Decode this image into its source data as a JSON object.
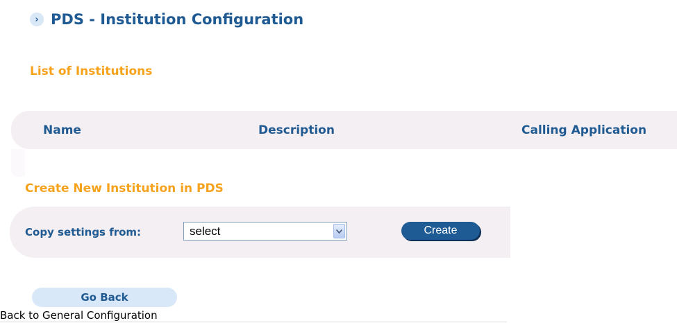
{
  "page": {
    "title": "PDS - Institution Configuration",
    "title_icon": "chevron-right-icon"
  },
  "institutions": {
    "heading": "List of Institutions",
    "columns": [
      "Name",
      "Description",
      "Calling Application"
    ],
    "rows": []
  },
  "create": {
    "heading": "Create New Institution in PDS",
    "copy_label": "Copy settings from:",
    "select_value": "select",
    "select_icon": "chevron-down-icon",
    "create_label": "Create"
  },
  "footer": {
    "go_back_label": "Go Back",
    "back_link": "Back to General Configuration"
  },
  "colors": {
    "title_blue": "#1f5a92",
    "heading_orange": "#f6a21c",
    "panel_bg": "#f4eff3",
    "button_blue": "#1e5a93",
    "go_back_bg": "#d9e8f8"
  }
}
